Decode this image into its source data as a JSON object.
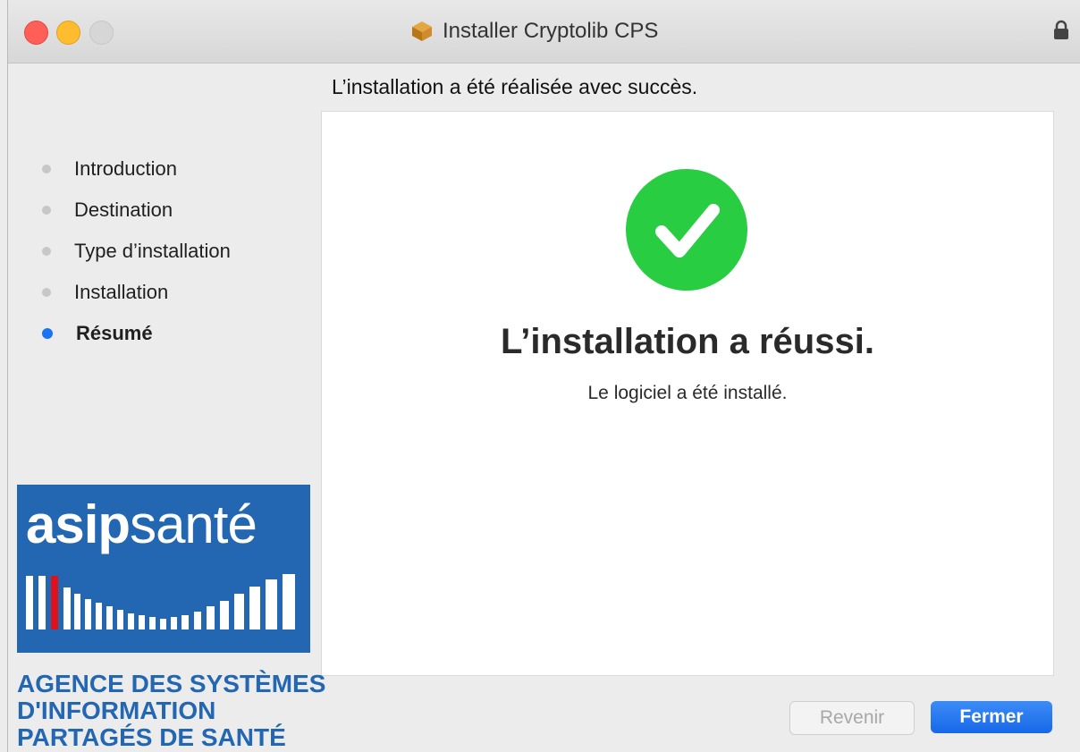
{
  "window": {
    "title": "Installer Cryptolib CPS"
  },
  "header": {
    "status_text": "L’installation a été réalisée avec succès."
  },
  "sidebar": {
    "steps": [
      {
        "label": "Introduction",
        "active": false
      },
      {
        "label": "Destination",
        "active": false
      },
      {
        "label": "Type d’installation",
        "active": false
      },
      {
        "label": "Installation",
        "active": false
      },
      {
        "label": "Résumé",
        "active": true
      }
    ],
    "logo": {
      "text_bold": "asip",
      "text_light": "santé"
    },
    "org_name_lines": [
      "AGENCE DES SYSTÈMES",
      "D'INFORMATION",
      "PARTAGÉS DE SANTÉ"
    ]
  },
  "main": {
    "icon": "check-circle-icon",
    "title": "L’installation a réussi.",
    "subtitle": "Le logiciel a été installé."
  },
  "buttons": {
    "back_label": "Revenir",
    "close_label": "Fermer"
  },
  "colors": {
    "accent": "#1a72f5",
    "success": "#28cd41",
    "logo_blue": "#2367b3",
    "traffic_red": "#ff5f57",
    "traffic_yellow": "#febc2e"
  }
}
